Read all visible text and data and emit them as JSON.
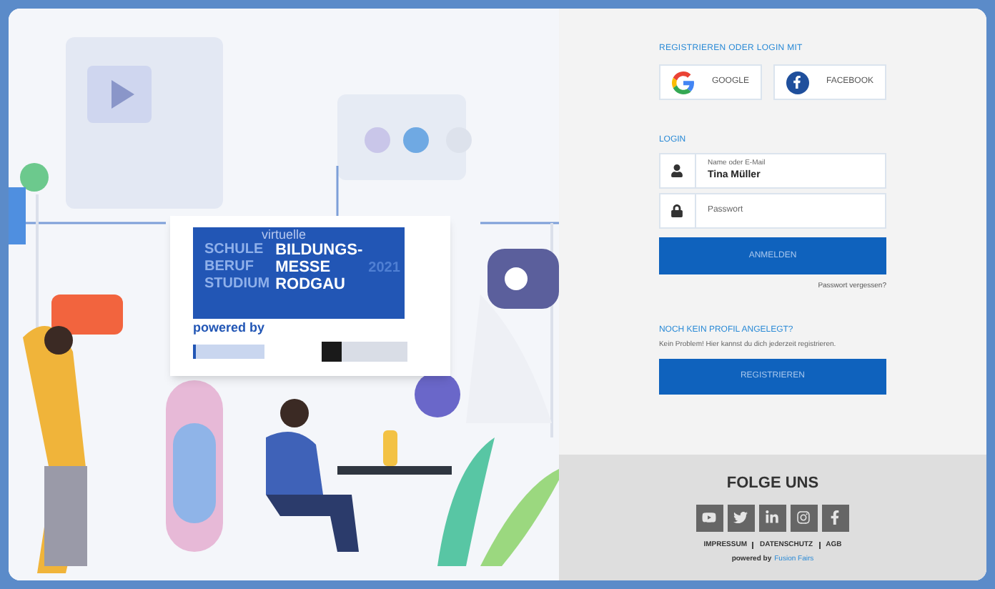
{
  "event_logo": {
    "overline": "virtuelle",
    "words_back": [
      "SCHULE",
      "BERUF",
      "STUDIUM"
    ],
    "title_lines": [
      "BILDUNGS-",
      "MESSE",
      "RODGAU"
    ],
    "year": "2021",
    "powered": "powered by"
  },
  "social_login": {
    "heading": "REGISTRIEREN ODER LOGIN MIT",
    "buttons": [
      {
        "kind": "google",
        "label": "GOOGLE"
      },
      {
        "kind": "facebook",
        "label": "FACEBOOK"
      }
    ]
  },
  "login": {
    "heading": "LOGIN",
    "fields": [
      {
        "kind": "user",
        "label": "Name oder E-Mail",
        "value": "Tina Müller"
      },
      {
        "kind": "password",
        "placeholder": "Passwort"
      }
    ],
    "submit": "ANMELDEN",
    "forgot": "Passwort vergessen?"
  },
  "register": {
    "heading": "NOCH KEIN PROFIL ANGELEGT?",
    "text": "Kein Problem! Hier kannst du dich jederzeit registrieren.",
    "button": "REGISTRIEREN"
  },
  "footer": {
    "heading": "FOLGE UNS",
    "social": [
      {
        "kind": "youtube"
      },
      {
        "kind": "twitter"
      },
      {
        "kind": "linkedin"
      },
      {
        "kind": "instagram"
      },
      {
        "kind": "facebook"
      }
    ],
    "links": [
      "IMPRESSUM",
      "DATENSCHUTZ",
      "AGB"
    ],
    "powered_prefix": "powered by",
    "powered_link": "Fusion Fairs"
  }
}
